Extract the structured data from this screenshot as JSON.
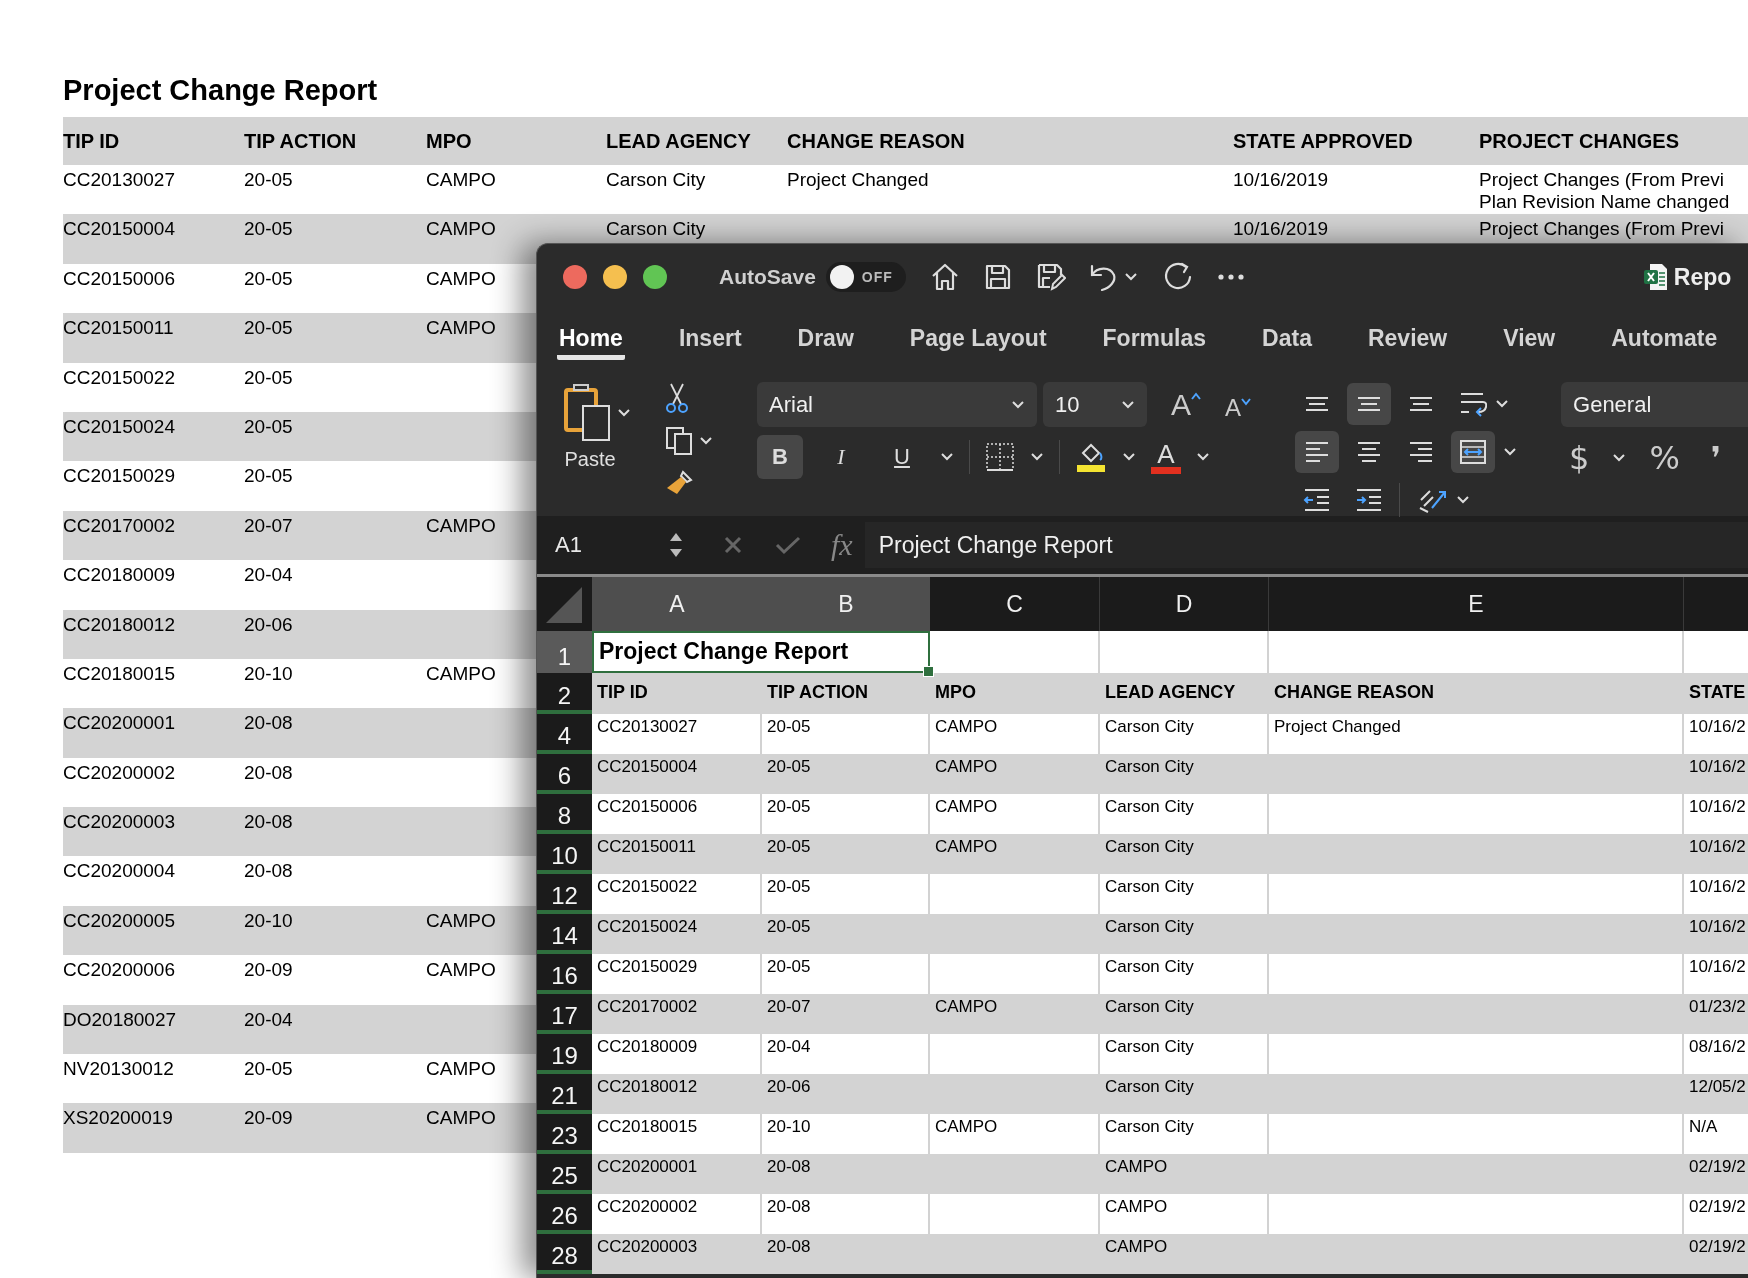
{
  "report": {
    "title": "Project Change Report",
    "columns": [
      "TIP ID",
      "TIP ACTION",
      "MPO",
      "LEAD AGENCY",
      "CHANGE REASON",
      "STATE APPROVED",
      "PROJECT CHANGES"
    ],
    "rows": [
      {
        "tip_id": "CC20130027",
        "tip_action": "20-05",
        "mpo": "CAMPO",
        "lead_agency": "Carson City",
        "change_reason": "Project Changed",
        "state_approved": "10/16/2019",
        "project_changes": [
          "Project Changes (From Previ",
          "Plan Revision Name changed"
        ]
      },
      {
        "tip_id": "CC20150004",
        "tip_action": "20-05",
        "mpo": "CAMPO",
        "lead_agency": "Carson City",
        "state_approved": "10/16/2019",
        "project_changes": [
          "Project Changes (From Previ"
        ]
      },
      {
        "tip_id": "CC20150006",
        "tip_action": "20-05",
        "mpo": "CAMPO"
      },
      {
        "tip_id": "CC20150011",
        "tip_action": "20-05",
        "mpo": "CAMPO"
      },
      {
        "tip_id": "CC20150022",
        "tip_action": "20-05"
      },
      {
        "tip_id": "CC20150024",
        "tip_action": "20-05"
      },
      {
        "tip_id": "CC20150029",
        "tip_action": "20-05"
      },
      {
        "tip_id": "CC20170002",
        "tip_action": "20-07",
        "mpo": "CAMPO"
      },
      {
        "tip_id": "CC20180009",
        "tip_action": "20-04"
      },
      {
        "tip_id": "CC20180012",
        "tip_action": "20-06"
      },
      {
        "tip_id": "CC20180015",
        "tip_action": "20-10",
        "mpo": "CAMPO"
      },
      {
        "tip_id": "CC20200001",
        "tip_action": "20-08"
      },
      {
        "tip_id": "CC20200002",
        "tip_action": "20-08"
      },
      {
        "tip_id": "CC20200003",
        "tip_action": "20-08"
      },
      {
        "tip_id": "CC20200004",
        "tip_action": "20-08"
      },
      {
        "tip_id": "CC20200005",
        "tip_action": "20-10",
        "mpo": "CAMPO"
      },
      {
        "tip_id": "CC20200006",
        "tip_action": "20-09",
        "mpo": "CAMPO"
      },
      {
        "tip_id": "DO20180027",
        "tip_action": "20-04"
      },
      {
        "tip_id": "NV20130012",
        "tip_action": "20-05",
        "mpo": "CAMPO"
      },
      {
        "tip_id": "XS20200019",
        "tip_action": "20-09",
        "mpo": "CAMPO"
      }
    ]
  },
  "excel": {
    "titlebar": {
      "autosave_label": "AutoSave",
      "autosave_toggle": {
        "on": false,
        "label": "OFF"
      },
      "document_title": "Repo"
    },
    "tabs": [
      {
        "label": "Home",
        "selected": true
      },
      {
        "label": "Insert",
        "selected": false
      },
      {
        "label": "Draw",
        "selected": false
      },
      {
        "label": "Page Layout",
        "selected": false
      },
      {
        "label": "Formulas",
        "selected": false
      },
      {
        "label": "Data",
        "selected": false
      },
      {
        "label": "Review",
        "selected": false
      },
      {
        "label": "View",
        "selected": false
      },
      {
        "label": "Automate",
        "selected": false
      }
    ],
    "ribbon": {
      "paste_label": "Paste",
      "font_name": "Arial",
      "font_size": "10",
      "font_size_buttons": [
        "A",
        "A"
      ],
      "styles": [
        {
          "label": "B",
          "selected": true
        },
        {
          "label": "I",
          "selected": false
        },
        {
          "label": "U",
          "selected": false
        }
      ],
      "fill_color": {
        "color": "#f4e431"
      },
      "font_color": {
        "label": "A",
        "color": "#e2301f"
      },
      "vertical_align": [
        {
          "selected": false
        },
        {
          "selected": true
        },
        {
          "selected": false
        }
      ],
      "horizontal_align": [
        {
          "selected": true
        },
        {
          "selected": false
        },
        {
          "selected": false
        }
      ],
      "merge": {
        "selected": true
      },
      "number_format": "General",
      "number_buttons": [
        "$",
        "%",
        "❜"
      ]
    },
    "formula_bar": {
      "name_box": "A1",
      "fx": "fx",
      "formula": "Project Change Report"
    },
    "grid": {
      "columns": [
        {
          "letter": "A",
          "selected": true
        },
        {
          "letter": "B",
          "selected": true
        },
        {
          "letter": "C",
          "selected": false
        },
        {
          "letter": "D",
          "selected": false
        },
        {
          "letter": "E",
          "selected": false
        }
      ],
      "rows": [
        {
          "kind": "title",
          "number": "1",
          "selected": true,
          "text": "Project Change Report"
        },
        {
          "kind": "header",
          "number": "2",
          "selected": false,
          "cells": {
            "tip_id": "TIP ID",
            "tip_action": "TIP ACTION",
            "mpo": "MPO",
            "lead_agency": "LEAD AGENCY",
            "change_reason": "CHANGE REASON",
            "state_approved": "STATE"
          }
        },
        {
          "kind": "data",
          "number": "4",
          "selected": false,
          "cells": {
            "tip_id": "CC20130027",
            "tip_action": "20-05",
            "mpo": "CAMPO",
            "lead_agency": "Carson City",
            "change_reason": "Project Changed",
            "state_approved": "10/16/2"
          }
        },
        {
          "kind": "data",
          "number": "6",
          "selected": false,
          "cells": {
            "tip_id": "CC20150004",
            "tip_action": "20-05",
            "mpo": "CAMPO",
            "lead_agency": "Carson City",
            "state_approved": "10/16/2"
          }
        },
        {
          "kind": "data",
          "number": "8",
          "selected": false,
          "cells": {
            "tip_id": "CC20150006",
            "tip_action": "20-05",
            "mpo": "CAMPO",
            "lead_agency": "Carson City",
            "state_approved": "10/16/2"
          }
        },
        {
          "kind": "data",
          "number": "10",
          "selected": false,
          "cells": {
            "tip_id": "CC20150011",
            "tip_action": "20-05",
            "mpo": "CAMPO",
            "lead_agency": "Carson City",
            "state_approved": "10/16/2"
          }
        },
        {
          "kind": "data",
          "number": "12",
          "selected": false,
          "cells": {
            "tip_id": "CC20150022",
            "tip_action": "20-05",
            "lead_agency": "Carson City",
            "state_approved": "10/16/2"
          }
        },
        {
          "kind": "data",
          "number": "14",
          "selected": false,
          "cells": {
            "tip_id": "CC20150024",
            "tip_action": "20-05",
            "lead_agency": "Carson City",
            "state_approved": "10/16/2"
          }
        },
        {
          "kind": "data",
          "number": "16",
          "selected": false,
          "cells": {
            "tip_id": "CC20150029",
            "tip_action": "20-05",
            "lead_agency": "Carson City",
            "state_approved": "10/16/2"
          }
        },
        {
          "kind": "data",
          "number": "17",
          "selected": false,
          "cells": {
            "tip_id": "CC20170002",
            "tip_action": "20-07",
            "mpo": "CAMPO",
            "lead_agency": "Carson City",
            "state_approved": "01/23/2"
          }
        },
        {
          "kind": "data",
          "number": "19",
          "selected": false,
          "cells": {
            "tip_id": "CC20180009",
            "tip_action": "20-04",
            "lead_agency": "Carson City",
            "state_approved": "08/16/2"
          }
        },
        {
          "kind": "data",
          "number": "21",
          "selected": false,
          "cells": {
            "tip_id": "CC20180012",
            "tip_action": "20-06",
            "lead_agency": "Carson City",
            "state_approved": "12/05/2"
          }
        },
        {
          "kind": "data",
          "number": "23",
          "selected": false,
          "cells": {
            "tip_id": "CC20180015",
            "tip_action": "20-10",
            "mpo": "CAMPO",
            "lead_agency": "Carson City",
            "state_approved": "N/A"
          }
        },
        {
          "kind": "data",
          "number": "25",
          "selected": false,
          "cells": {
            "tip_id": "CC20200001",
            "tip_action": "20-08",
            "lead_agency": "CAMPO",
            "state_approved": "02/19/2"
          }
        },
        {
          "kind": "data",
          "number": "26",
          "selected": false,
          "cells": {
            "tip_id": "CC20200002",
            "tip_action": "20-08",
            "lead_agency": "CAMPO",
            "state_approved": "02/19/2"
          }
        },
        {
          "kind": "data",
          "number": "28",
          "selected": false,
          "cells": {
            "tip_id": "CC20200003",
            "tip_action": "20-08",
            "lead_agency": "CAMPO",
            "state_approved": "02/19/2"
          }
        }
      ]
    }
  }
}
